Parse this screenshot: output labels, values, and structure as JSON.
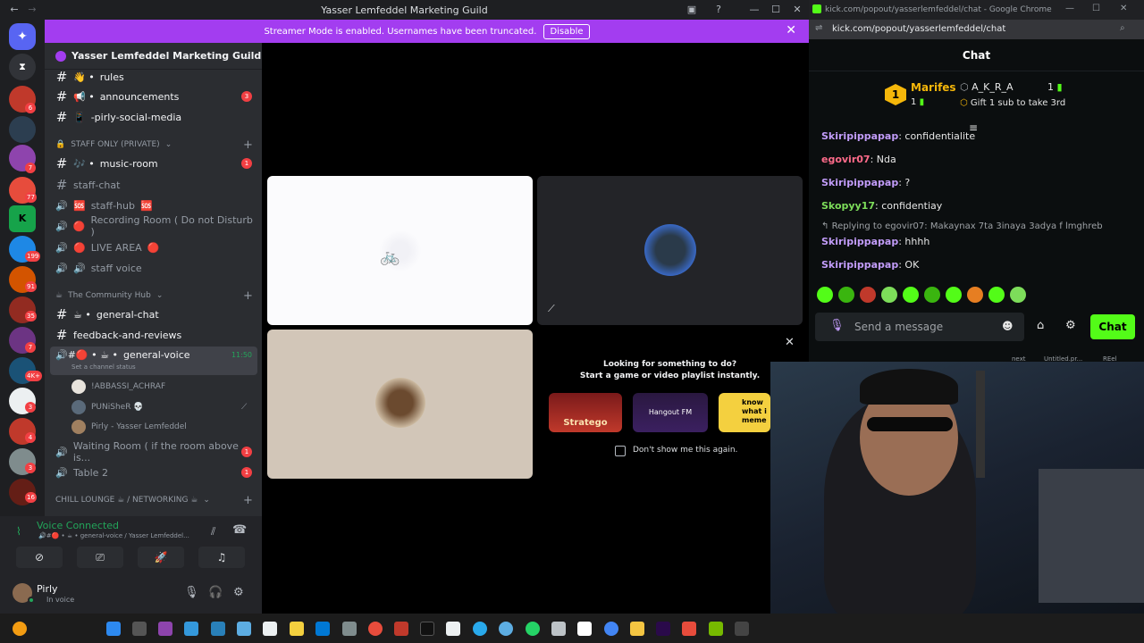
{
  "discord": {
    "window_title": "Yasser Lemfeddel Marketing Guild",
    "banner": {
      "text": "Streamer Mode is enabled. Usernames have been truncated.",
      "button": "Disable"
    },
    "guild_name": "Yasser Lemfeddel Marketing Guild",
    "server_badges": [
      "6",
      "7",
      "77",
      "199",
      "91",
      "35",
      "7",
      "4K+",
      "3",
      "4",
      "3",
      "16"
    ],
    "channels": [
      {
        "name": "rules",
        "prefix": "👋 •",
        "type": "text",
        "unread": true
      },
      {
        "name": "announcements",
        "prefix": "📢 •",
        "type": "text",
        "unread": true,
        "count": "3"
      },
      {
        "name": "-pirly-social-media",
        "prefix": "📱",
        "type": "text",
        "unread": true
      }
    ],
    "category_staff": "STAFF ONLY (PRIVATE)",
    "staff_channels": [
      {
        "name": "music-room",
        "prefix": "🎶 •",
        "type": "text",
        "unread": true,
        "count": "1"
      },
      {
        "name": "staff-chat",
        "type": "text"
      },
      {
        "name": "staff-hub",
        "prefix": "🆘",
        "suffix": "🆘",
        "type": "voice"
      },
      {
        "name": "Recording Room ( Do not Disturb )",
        "prefix": "🔴",
        "type": "voice"
      },
      {
        "name": "LIVE AREA",
        "prefix": "🔴",
        "suffix": "🔴",
        "type": "voice"
      },
      {
        "name": "staff voice",
        "prefix": "🔊",
        "type": "voice"
      }
    ],
    "category_community": "The Community Hub",
    "community_channels": [
      {
        "name": "general-chat",
        "prefix": "☕ •",
        "type": "text",
        "unread": true
      },
      {
        "name": "feedback-and-reviews",
        "type": "text",
        "unread": true
      },
      {
        "name": "general-voice",
        "prefix": "🔊#🔴 • ☕ •",
        "type": "voice",
        "unread": true,
        "time": "11:50",
        "status": "Set a channel status"
      }
    ],
    "voice_users": [
      "!ABBASSI_ACHRAF",
      "PUNiSheR 💀",
      "Pirly - Yasser Lemfeddel"
    ],
    "more_channels": [
      {
        "name": "Waiting Room ( if the room above is...",
        "type": "voice",
        "count": "1"
      },
      {
        "name": "Table 2",
        "type": "voice",
        "count": "1"
      }
    ],
    "category_chill": "CHILL LOUNGE ☕ / NETWORKING ☕",
    "voice_connected": "Voice Connected",
    "voice_channel": "🔊#🔴 • ☕ • general-voice / Yasser Lemfeddel...",
    "user": {
      "name": "Pirly",
      "status": "In voice"
    },
    "activity": {
      "title": "Looking for something to do?",
      "subtitle": "Start a game or video playlist instantly.",
      "cards": [
        "Stratego",
        "Hangout FM",
        "know what i meme"
      ],
      "checkbox": "Don't show me this again."
    }
  },
  "kick": {
    "window_title": "kick.com/popout/yasserlemfeddel/chat - Google Chrome",
    "url": "kick.com/popout/yasserlemfeddel/chat",
    "header": "Chat",
    "leader": {
      "rank": "1",
      "name": "Marifes",
      "subs": "1",
      "second": "A_K_R_A",
      "second_subs": "1",
      "gift": "Gift 1 sub to take 3rd"
    },
    "messages": [
      {
        "user": "Skiripippapap",
        "text": "confidentialite",
        "color": "#c29cf9"
      },
      {
        "user": "egovir07",
        "text": "Nda",
        "color": "#ff6b8a"
      },
      {
        "user": "Skiripippapap",
        "text": "?",
        "color": "#c29cf9"
      },
      {
        "user": "Skopyy17",
        "text": "confidentiay",
        "color": "#7ddd5a"
      },
      {
        "reply": "Replying to egovir07: Makaynax 7ta 3inaya 3adya f lmghreb"
      },
      {
        "user": "Skiripippapap",
        "text": "hhhh",
        "color": "#c29cf9"
      },
      {
        "user": "Skiripippapap",
        "text": "OK",
        "color": "#c29cf9"
      }
    ],
    "input_placeholder": "Send a message",
    "chat_button": "Chat",
    "behind_labels": [
      "next",
      "Untitled.pr...",
      "REel"
    ]
  },
  "colors": {
    "discord_accent": "#a33df0",
    "kick_green": "#53fc18",
    "discord_red": "#f23f43",
    "voice_green": "#23a55a"
  }
}
